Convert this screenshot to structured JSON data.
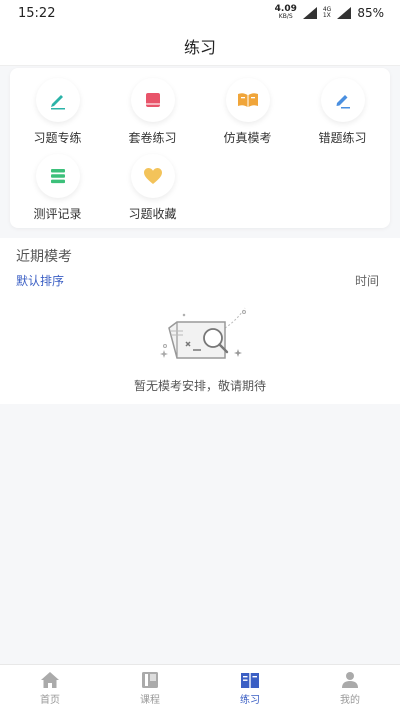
{
  "status_bar": {
    "time": "15:22",
    "net_speed": "4.09",
    "net_unit": "KB/S",
    "network_type_top": "4G",
    "network_type_bottom": "1X",
    "battery": "85%"
  },
  "header": {
    "title": "练习"
  },
  "practice_menu": [
    {
      "label": "习题专练",
      "icon": "pencil-icon",
      "color": "#2bb3a8"
    },
    {
      "label": "套卷练习",
      "icon": "booklet-icon",
      "color": "#e8546a"
    },
    {
      "label": "仿真模考",
      "icon": "open-book-icon",
      "color": "#f0a53a"
    },
    {
      "label": "错题练习",
      "icon": "edit-icon",
      "color": "#4a8fe0"
    },
    {
      "label": "测评记录",
      "icon": "list-icon",
      "color": "#3cc07a"
    },
    {
      "label": "习题收藏",
      "icon": "heart-icon",
      "color": "#f3c35a"
    }
  ],
  "recent_exams": {
    "title": "近期模考",
    "sort_default": "默认排序",
    "sort_time": "时间",
    "empty_text": "暂无模考安排，敬请期待"
  },
  "tabs": [
    {
      "label": "首页",
      "icon": "home-icon",
      "active": false
    },
    {
      "label": "课程",
      "icon": "course-icon",
      "active": false
    },
    {
      "label": "练习",
      "icon": "practice-icon",
      "active": true
    },
    {
      "label": "我的",
      "icon": "profile-icon",
      "active": false
    }
  ],
  "colors": {
    "accent": "#3b5fc4",
    "inactive_tab": "#aaaaaa"
  }
}
